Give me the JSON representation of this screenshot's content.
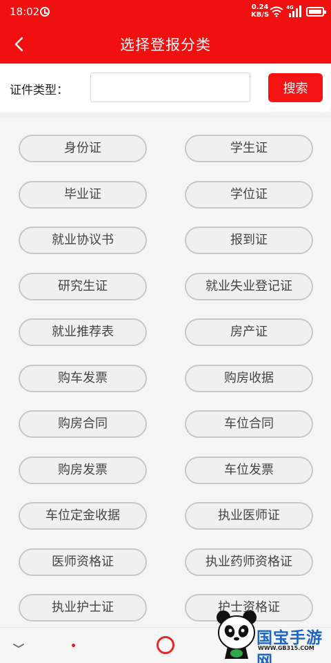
{
  "status_bar": {
    "time": "18:02",
    "net_speed_value": "0.24",
    "net_speed_unit": "KB/S",
    "network_type": "4G",
    "icons": [
      "alarm-icon",
      "wifi-icon",
      "signal-icon",
      "battery-icon"
    ]
  },
  "header": {
    "title": "选择登报分类",
    "back_icon": "chevron-left-icon"
  },
  "search": {
    "label": "证件类型：",
    "input_value": "",
    "input_placeholder": "",
    "button_label": "搜索"
  },
  "categories": [
    "身份证",
    "学生证",
    "毕业证",
    "学位证",
    "就业协议书",
    "报到证",
    "研究生证",
    "就业失业登记证",
    "就业推荐表",
    "房产证",
    "购车发票",
    "购房收据",
    "购房合同",
    "车位合同",
    "购房发票",
    "车位发票",
    "车位定金收据",
    "执业医师证",
    "医师资格证",
    "执业药师资格证",
    "执业护士证",
    "护士资格证"
  ],
  "nav_bar": {
    "icons": [
      "chevron-down-icon",
      "dot-icon",
      "circle-home-icon"
    ]
  },
  "watermark": {
    "text": "国宝手游网",
    "url": "WWW.GB315.COM"
  },
  "colors": {
    "primary_red": "#f01010",
    "button_red": "#f51414",
    "chip_border": "#c7c7c7",
    "chip_background": "#f0f0f0",
    "watermark_blue": "#1c64c8"
  }
}
